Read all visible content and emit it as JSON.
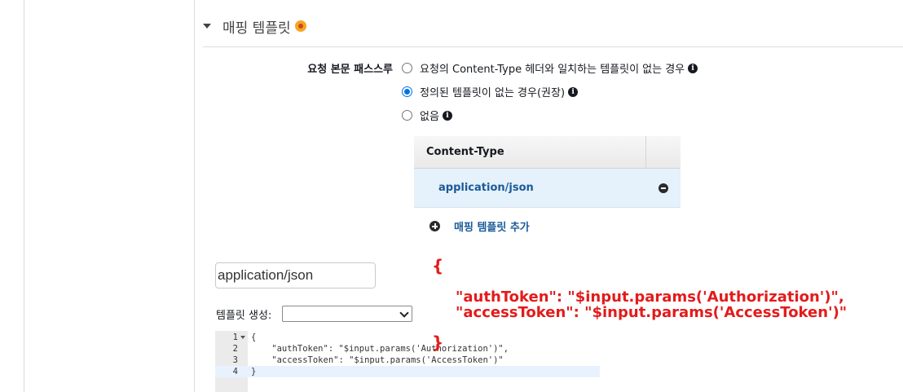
{
  "section": {
    "title": "매핑 템플릿"
  },
  "passthrough": {
    "label": "요청 본문 패스스루",
    "options": [
      {
        "label": "요청의 Content-Type 헤더와 일치하는 템플릿이 없는 경우",
        "checked": false
      },
      {
        "label": "정의된 템플릿이 없는 경우(권장)",
        "checked": true
      },
      {
        "label": "없음",
        "checked": false
      }
    ]
  },
  "content_type_table": {
    "header": "Content-Type",
    "rows": [
      "application/json"
    ]
  },
  "add_template": {
    "label": "매핑 템플릿 추가"
  },
  "content_type_input": {
    "value": "application/json"
  },
  "generate_template": {
    "label": "템플릿 생성:",
    "selected": ""
  },
  "editor": {
    "lines": [
      {
        "num": "1",
        "text": "{"
      },
      {
        "num": "2",
        "text": "    \"authToken\": \"$input.params('Authorization')\","
      },
      {
        "num": "3",
        "text": "    \"accessToken\": \"$input.params('AccessToken')\""
      },
      {
        "num": "4",
        "text": "}"
      }
    ]
  },
  "annotation": {
    "open_brace": "{",
    "line1": "\"authToken\": \"$input.params('Authorization')\",",
    "line2": "\"accessToken\": \"$input.params('AccessToken')\"",
    "close_brace": "}"
  },
  "colors": {
    "link": "#1a5a9a",
    "selected_row": "#e5f1fb",
    "annotation": "#e31b1b",
    "radio_accent": "#0073e6"
  }
}
